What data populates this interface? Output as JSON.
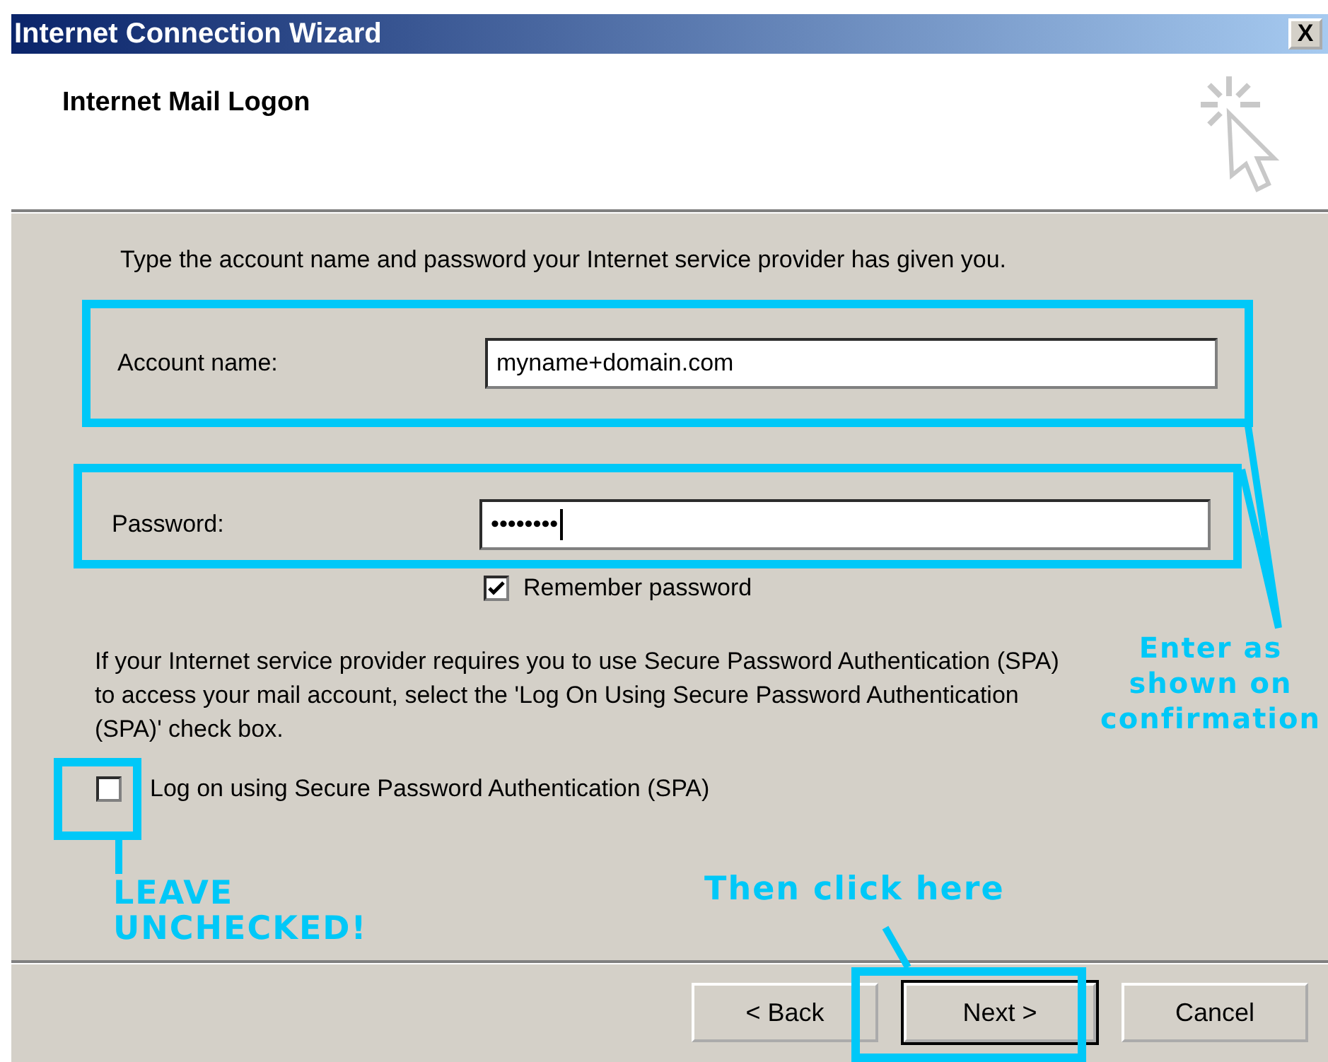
{
  "window": {
    "title": "Internet Connection Wizard",
    "close": "X"
  },
  "header": {
    "title": "Internet Mail Logon"
  },
  "instruction": "Type the account name and password your Internet service provider has given you.",
  "fields": [
    {
      "label": "Account name:",
      "value": "myname+domain.com",
      "kind": "text"
    },
    {
      "label": "Password:",
      "value": "••••••••",
      "kind": "password"
    }
  ],
  "remember": {
    "label": "Remember password",
    "checked": true
  },
  "spa_text": "If your Internet service provider requires you to use Secure Password Authentication (SPA) to access your mail account, select the 'Log On Using Secure Password Authentication (SPA)' check box.",
  "spa": {
    "label": "Log on using Secure Password Authentication (SPA)",
    "checked": false
  },
  "buttons": [
    {
      "label": "< Back",
      "default": false
    },
    {
      "label": "Next >",
      "default": true
    },
    {
      "label": "Cancel",
      "default": false
    }
  ],
  "annotations": {
    "enter": "Enter as shown on confirmation",
    "leave": "LEAVE UNCHECKED!",
    "click": "Then click here"
  }
}
